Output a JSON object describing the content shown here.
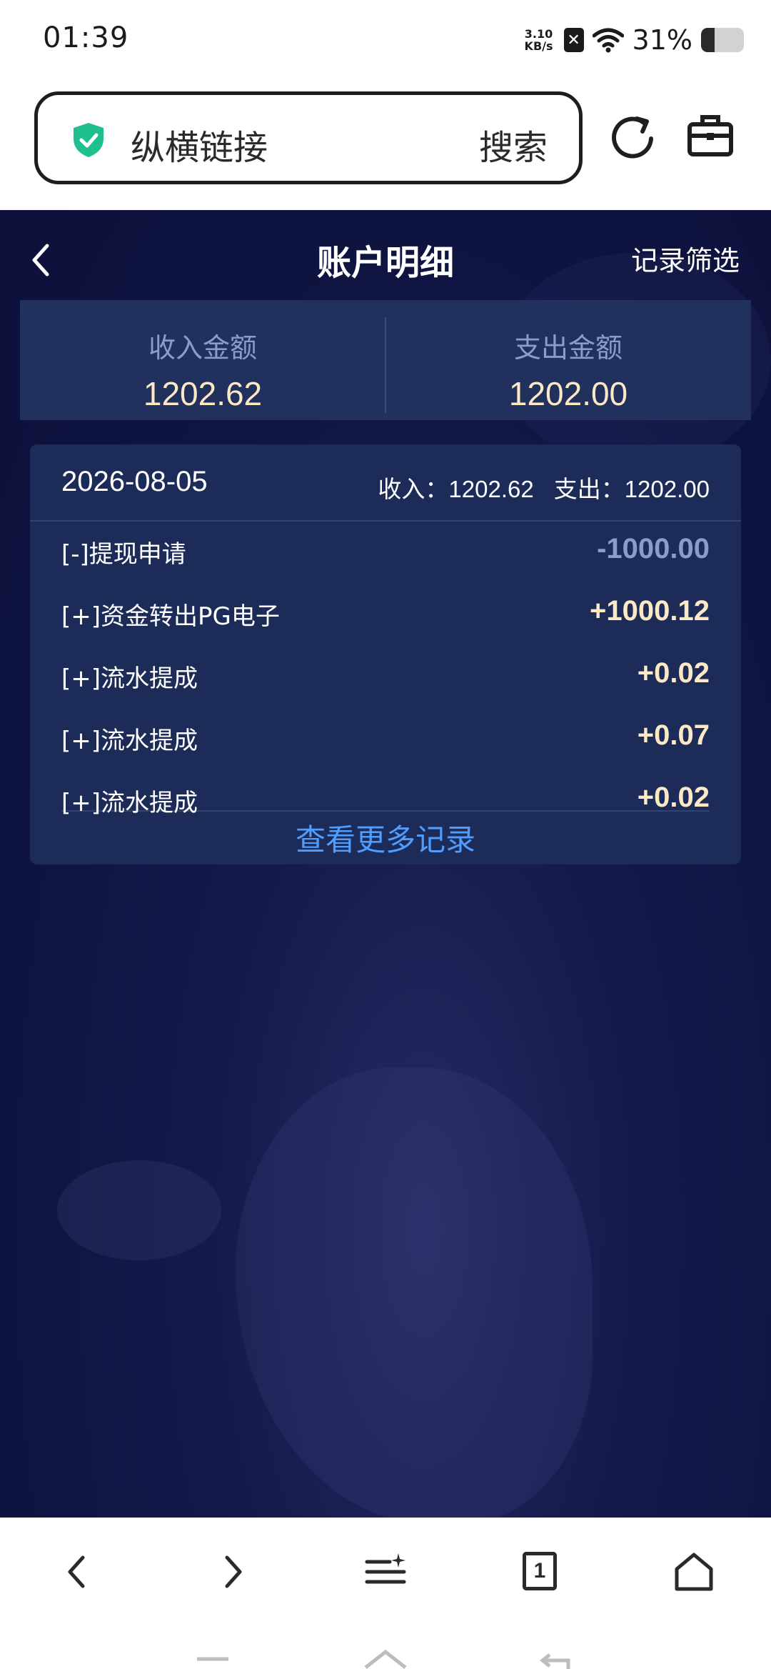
{
  "status_bar": {
    "time": "01:39",
    "net_speed_value": "3.10",
    "net_speed_unit": "KB/s",
    "sim_icon": "sim-x-icon",
    "battery_percent": "31%",
    "battery_level": 0.31
  },
  "browser": {
    "address_text": "纵横链接",
    "search_label": "搜索",
    "security_icon": "shield-check-icon",
    "shield_color": "#1fbf8f"
  },
  "page": {
    "title": "账户明细",
    "filter_label": "记录筛选"
  },
  "summary": {
    "income_label": "收入金额",
    "income_value": "1202.62",
    "expense_label": "支出金额",
    "expense_value": "1202.00"
  },
  "day": {
    "date": "2026-08-05",
    "income_text": "收入：1202.62",
    "expense_text": "支出：1202.00",
    "records": [
      {
        "label": "[-]提现申请",
        "amount": "-1000.00"
      },
      {
        "label": "[+]资金转出PG电子",
        "amount": "+1000.12"
      },
      {
        "label": "[+]流水提成",
        "amount": "+0.02"
      },
      {
        "label": "[+]流水提成",
        "amount": "+0.07"
      },
      {
        "label": "[+]流水提成",
        "amount": "+0.02"
      }
    ],
    "more_label": "查看更多记录"
  },
  "toolbar": {
    "tab_count": "1"
  },
  "colors": {
    "app_bg": "#0f1340",
    "card_bg": "#1d2b58",
    "amount_positive": "#fbe9c6",
    "amount_negative": "#8a9cc8",
    "link": "#4f9eff"
  }
}
